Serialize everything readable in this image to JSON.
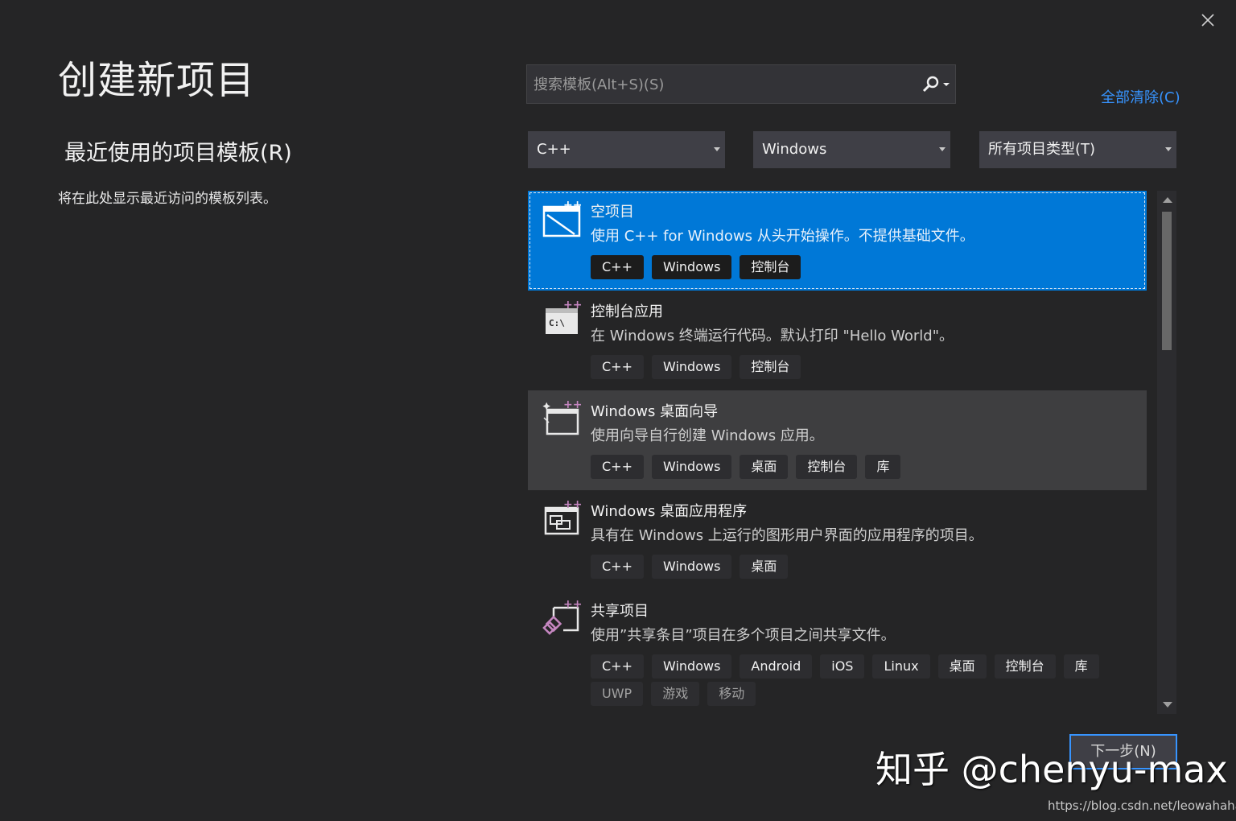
{
  "header": {
    "title": "创建新项目",
    "close_label": "关闭"
  },
  "recent": {
    "title": "最近使用的项目模板(R)",
    "description": "将在此处显示最近访问的模板列表。"
  },
  "search": {
    "placeholder": "搜索模板(Alt+S)(S)",
    "value": "",
    "clear_all_label": "全部清除(C)"
  },
  "filters": [
    {
      "selected": "C++"
    },
    {
      "selected": "Windows"
    },
    {
      "selected": "所有项目类型(T)"
    }
  ],
  "templates": [
    {
      "title": "空项目",
      "description": "使用 C++ for Windows 从头开始操作。不提供基础文件。",
      "icon": "empty-project-icon",
      "state": "selected",
      "tags": [
        "C++",
        "Windows",
        "控制台"
      ]
    },
    {
      "title": "控制台应用",
      "description": "在 Windows 终端运行代码。默认打印 \"Hello World\"。",
      "icon": "console-app-icon",
      "state": "normal",
      "tags": [
        "C++",
        "Windows",
        "控制台"
      ]
    },
    {
      "title": "Windows 桌面向导",
      "description": "使用向导自行创建 Windows 应用。",
      "icon": "desktop-wizard-icon",
      "state": "hover",
      "tags": [
        "C++",
        "Windows",
        "桌面",
        "控制台",
        "库"
      ]
    },
    {
      "title": "Windows 桌面应用程序",
      "description": "具有在 Windows 上运行的图形用户界面的应用程序的项目。",
      "icon": "desktop-app-icon",
      "state": "normal",
      "tags": [
        "C++",
        "Windows",
        "桌面"
      ]
    },
    {
      "title": "共享项目",
      "description": "使用”共享条目”项目在多个项目之间共享文件。",
      "icon": "shared-project-icon",
      "state": "normal",
      "tags": [
        "C++",
        "Windows",
        "Android",
        "iOS",
        "Linux",
        "桌面",
        "控制台",
        "库",
        "UWP",
        "游戏",
        "移动"
      ],
      "dim_tags_from": 8
    }
  ],
  "footer": {
    "next_label": "下一步(N)"
  },
  "watermarks": {
    "zhihu": "知乎 @chenyu-max",
    "csdn": "https://blog.csdn.net/leowahaha"
  },
  "colors": {
    "background": "#252526",
    "accent": "#0078d7",
    "link": "#3794ff",
    "icon_plus": "#c586c0"
  }
}
